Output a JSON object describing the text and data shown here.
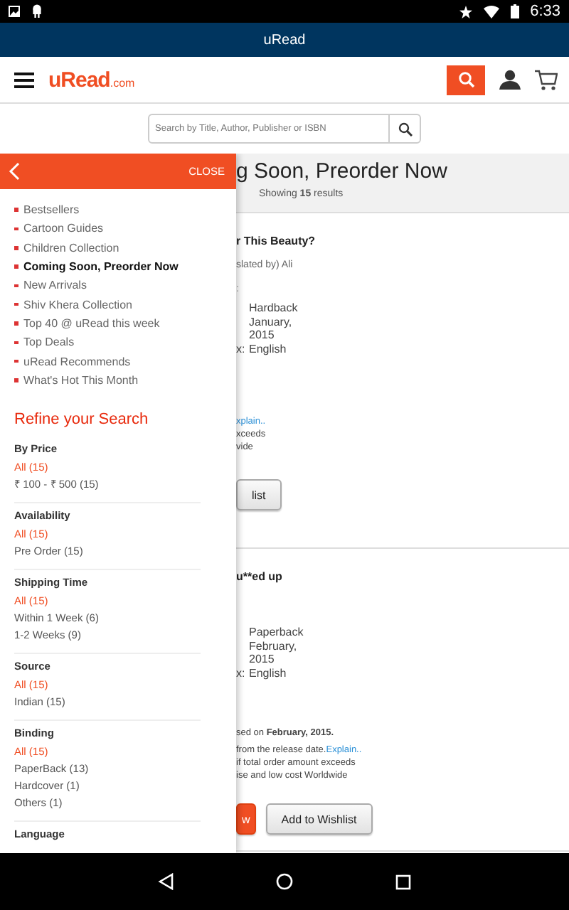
{
  "status_bar": {
    "time": "6:33"
  },
  "window": {
    "title": "uRead"
  },
  "header": {
    "logo": "uRead",
    "logo_suffix": ".com"
  },
  "search": {
    "placeholder": "Search by Title, Author, Publisher or ISBN"
  },
  "main": {
    "heading": "g Soon, Preorder Now",
    "results": "Showing **15** results",
    "cards": [
      {
        "title": "r This Beauty?",
        "byline": "slated by) Ali",
        "stub": ":",
        "details": [
          {
            "value": "Hardback"
          },
          {
            "value": "January,"
          },
          {
            "value": "2015"
          },
          {
            "label": "x:",
            "value": "English"
          }
        ],
        "notes": [
          {
            "link": "xplain.."
          },
          {
            "text": "xceeds"
          },
          {
            "text": "vide"
          }
        ],
        "buttons": [
          {
            "label": "list",
            "kind": "secondary"
          }
        ]
      },
      {
        "title": "u**ed up",
        "details": [
          {
            "value": "Paperback"
          },
          {
            "value": "February,"
          },
          {
            "value": "2015"
          },
          {
            "label": "x:",
            "value": "English"
          }
        ],
        "notes": [
          {
            "text": "sed on **February, 2015.**"
          },
          {
            "text": "from the release date.",
            "link": "Explain.."
          },
          {
            "text": "if total order amount exceeds"
          },
          {
            "text": "ise and low cost Worldwide"
          }
        ],
        "buttons": [
          {
            "label": "w",
            "kind": "primary"
          },
          {
            "label": "Add to Wishlist",
            "kind": "secondary"
          }
        ]
      }
    ]
  },
  "drawer": {
    "close": "CLOSE",
    "categories": [
      {
        "label": "Bestsellers",
        "selected": false
      },
      {
        "label": "Cartoon Guides",
        "selected": false
      },
      {
        "label": "Children Collection",
        "selected": false
      },
      {
        "label": "Coming Soon, Preorder Now",
        "selected": true
      },
      {
        "label": "New Arrivals",
        "selected": false
      },
      {
        "label": "Shiv Khera Collection",
        "selected": false
      },
      {
        "label": "Top 40 @ uRead this week",
        "selected": false
      },
      {
        "label": "Top Deals",
        "selected": false
      },
      {
        "label": "uRead Recommends",
        "selected": false
      },
      {
        "label": "What's Hot This Month",
        "selected": false
      }
    ],
    "refine_title": "Refine your Search",
    "filters": [
      {
        "title": "By Price",
        "options": [
          {
            "label": "All (15)",
            "selected": true
          },
          {
            "label": "₹ 100 - ₹ 500 (15)",
            "selected": false
          }
        ]
      },
      {
        "title": "Availability",
        "options": [
          {
            "label": "All (15)",
            "selected": true
          },
          {
            "label": "Pre Order (15)",
            "selected": false
          }
        ]
      },
      {
        "title": "Shipping Time",
        "options": [
          {
            "label": "All (15)",
            "selected": true
          },
          {
            "label": "Within 1 Week (6)",
            "selected": false
          },
          {
            "label": "1-2 Weeks (9)",
            "selected": false
          }
        ]
      },
      {
        "title": "Source",
        "options": [
          {
            "label": "All (15)",
            "selected": true
          },
          {
            "label": "Indian (15)",
            "selected": false
          }
        ]
      },
      {
        "title": "Binding",
        "options": [
          {
            "label": "All (15)",
            "selected": true
          },
          {
            "label": "PaperBack (13)",
            "selected": false
          },
          {
            "label": "Hardcover (1)",
            "selected": false
          },
          {
            "label": "Others (1)",
            "selected": false
          }
        ]
      },
      {
        "title": "Language"
      }
    ]
  }
}
